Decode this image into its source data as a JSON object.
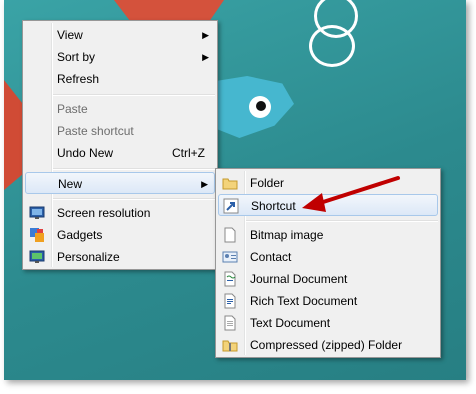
{
  "main_menu": {
    "items": [
      {
        "label": "View",
        "has_submenu": true
      },
      {
        "label": "Sort by",
        "has_submenu": true
      },
      {
        "label": "Refresh"
      },
      {
        "label": "Paste",
        "disabled": true
      },
      {
        "label": "Paste shortcut",
        "disabled": true
      },
      {
        "label": "Undo New",
        "shortcut": "Ctrl+Z"
      },
      {
        "label": "New",
        "has_submenu": true,
        "highlighted": true
      },
      {
        "label": "Screen resolution",
        "icon": "screen-resolution-icon"
      },
      {
        "label": "Gadgets",
        "icon": "gadgets-icon"
      },
      {
        "label": "Personalize",
        "icon": "personalize-icon"
      }
    ]
  },
  "new_submenu": {
    "items": [
      {
        "label": "Folder",
        "icon": "folder-icon"
      },
      {
        "label": "Shortcut",
        "icon": "shortcut-icon",
        "highlighted": true
      },
      {
        "label": "Bitmap image",
        "icon": "bitmap-icon"
      },
      {
        "label": "Contact",
        "icon": "contact-icon"
      },
      {
        "label": "Journal Document",
        "icon": "journal-icon"
      },
      {
        "label": "Rich Text Document",
        "icon": "rich-text-icon"
      },
      {
        "label": "Text Document",
        "icon": "text-document-icon"
      },
      {
        "label": "Compressed (zipped) Folder",
        "icon": "zip-folder-icon"
      }
    ]
  },
  "colors": {
    "highlight_border": "#a8c8ea",
    "annotation_arrow": "#c00000",
    "desktop": "#2f8e92"
  }
}
